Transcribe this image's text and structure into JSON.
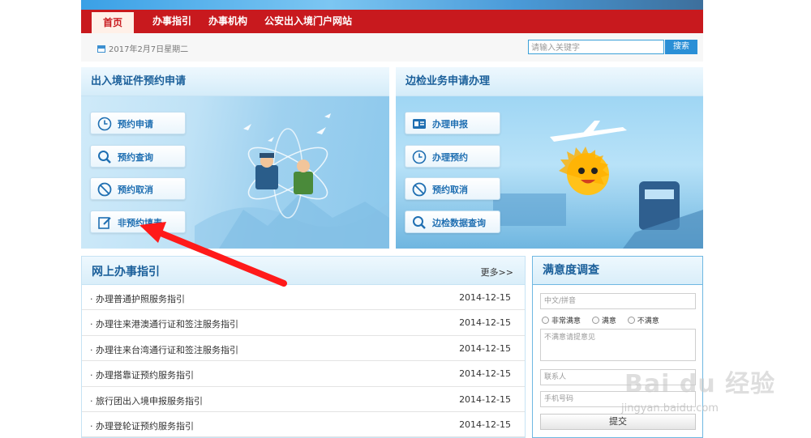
{
  "nav": {
    "items": [
      "首页",
      "办事指引",
      "办事机构",
      "公安出入境门户网站"
    ]
  },
  "datebar": {
    "date": "2017年2月7日星期二",
    "search_placeholder": "请输入关键字",
    "search_button": "搜索"
  },
  "panel_left": {
    "title": "出入境证件预约申请",
    "buttons": [
      {
        "label": "预约申请",
        "icon": "clock-icon"
      },
      {
        "label": "预约查询",
        "icon": "magnifier-icon"
      },
      {
        "label": "预约取消",
        "icon": "cancel-icon"
      },
      {
        "label": "非预约填表",
        "icon": "edit-icon"
      }
    ]
  },
  "panel_right": {
    "title": "边检业务申请办理",
    "buttons": [
      {
        "label": "办理申报",
        "icon": "id-card-icon"
      },
      {
        "label": "办理预约",
        "icon": "clock-icon"
      },
      {
        "label": "预约取消",
        "icon": "cancel-icon"
      },
      {
        "label": "边检数据查询",
        "icon": "magnifier-icon"
      }
    ]
  },
  "guide": {
    "title": "网上办事指引",
    "more": "更多>>",
    "rows": [
      {
        "text": "· 办理普通护照服务指引",
        "date": "2014-12-15"
      },
      {
        "text": "· 办理往来港澳通行证和签注服务指引",
        "date": "2014-12-15"
      },
      {
        "text": "· 办理往来台湾通行证和签注服务指引",
        "date": "2014-12-15"
      },
      {
        "text": "· 办理搭靠证预约服务指引",
        "date": "2014-12-15"
      },
      {
        "text": "· 旅行团出入境申报服务指引",
        "date": "2014-12-15"
      },
      {
        "text": "· 办理登轮证预约服务指引",
        "date": "2014-12-15"
      }
    ]
  },
  "survey": {
    "title": "满意度调查",
    "name_placeholder": "中文/拼音",
    "options": [
      "非常满意",
      "满意",
      "不满意"
    ],
    "comment_placeholder": "不满意请提意见",
    "contact_placeholder": "联系人",
    "phone_placeholder": "手机号码",
    "submit": "提交"
  },
  "watermark": {
    "main": "Bai du 经验",
    "sub": "jingyan.baidu.com"
  },
  "colors": {
    "nav_red": "#c8191e",
    "accent_blue": "#1f6fb2",
    "arrow_red": "#ff1a1a"
  }
}
